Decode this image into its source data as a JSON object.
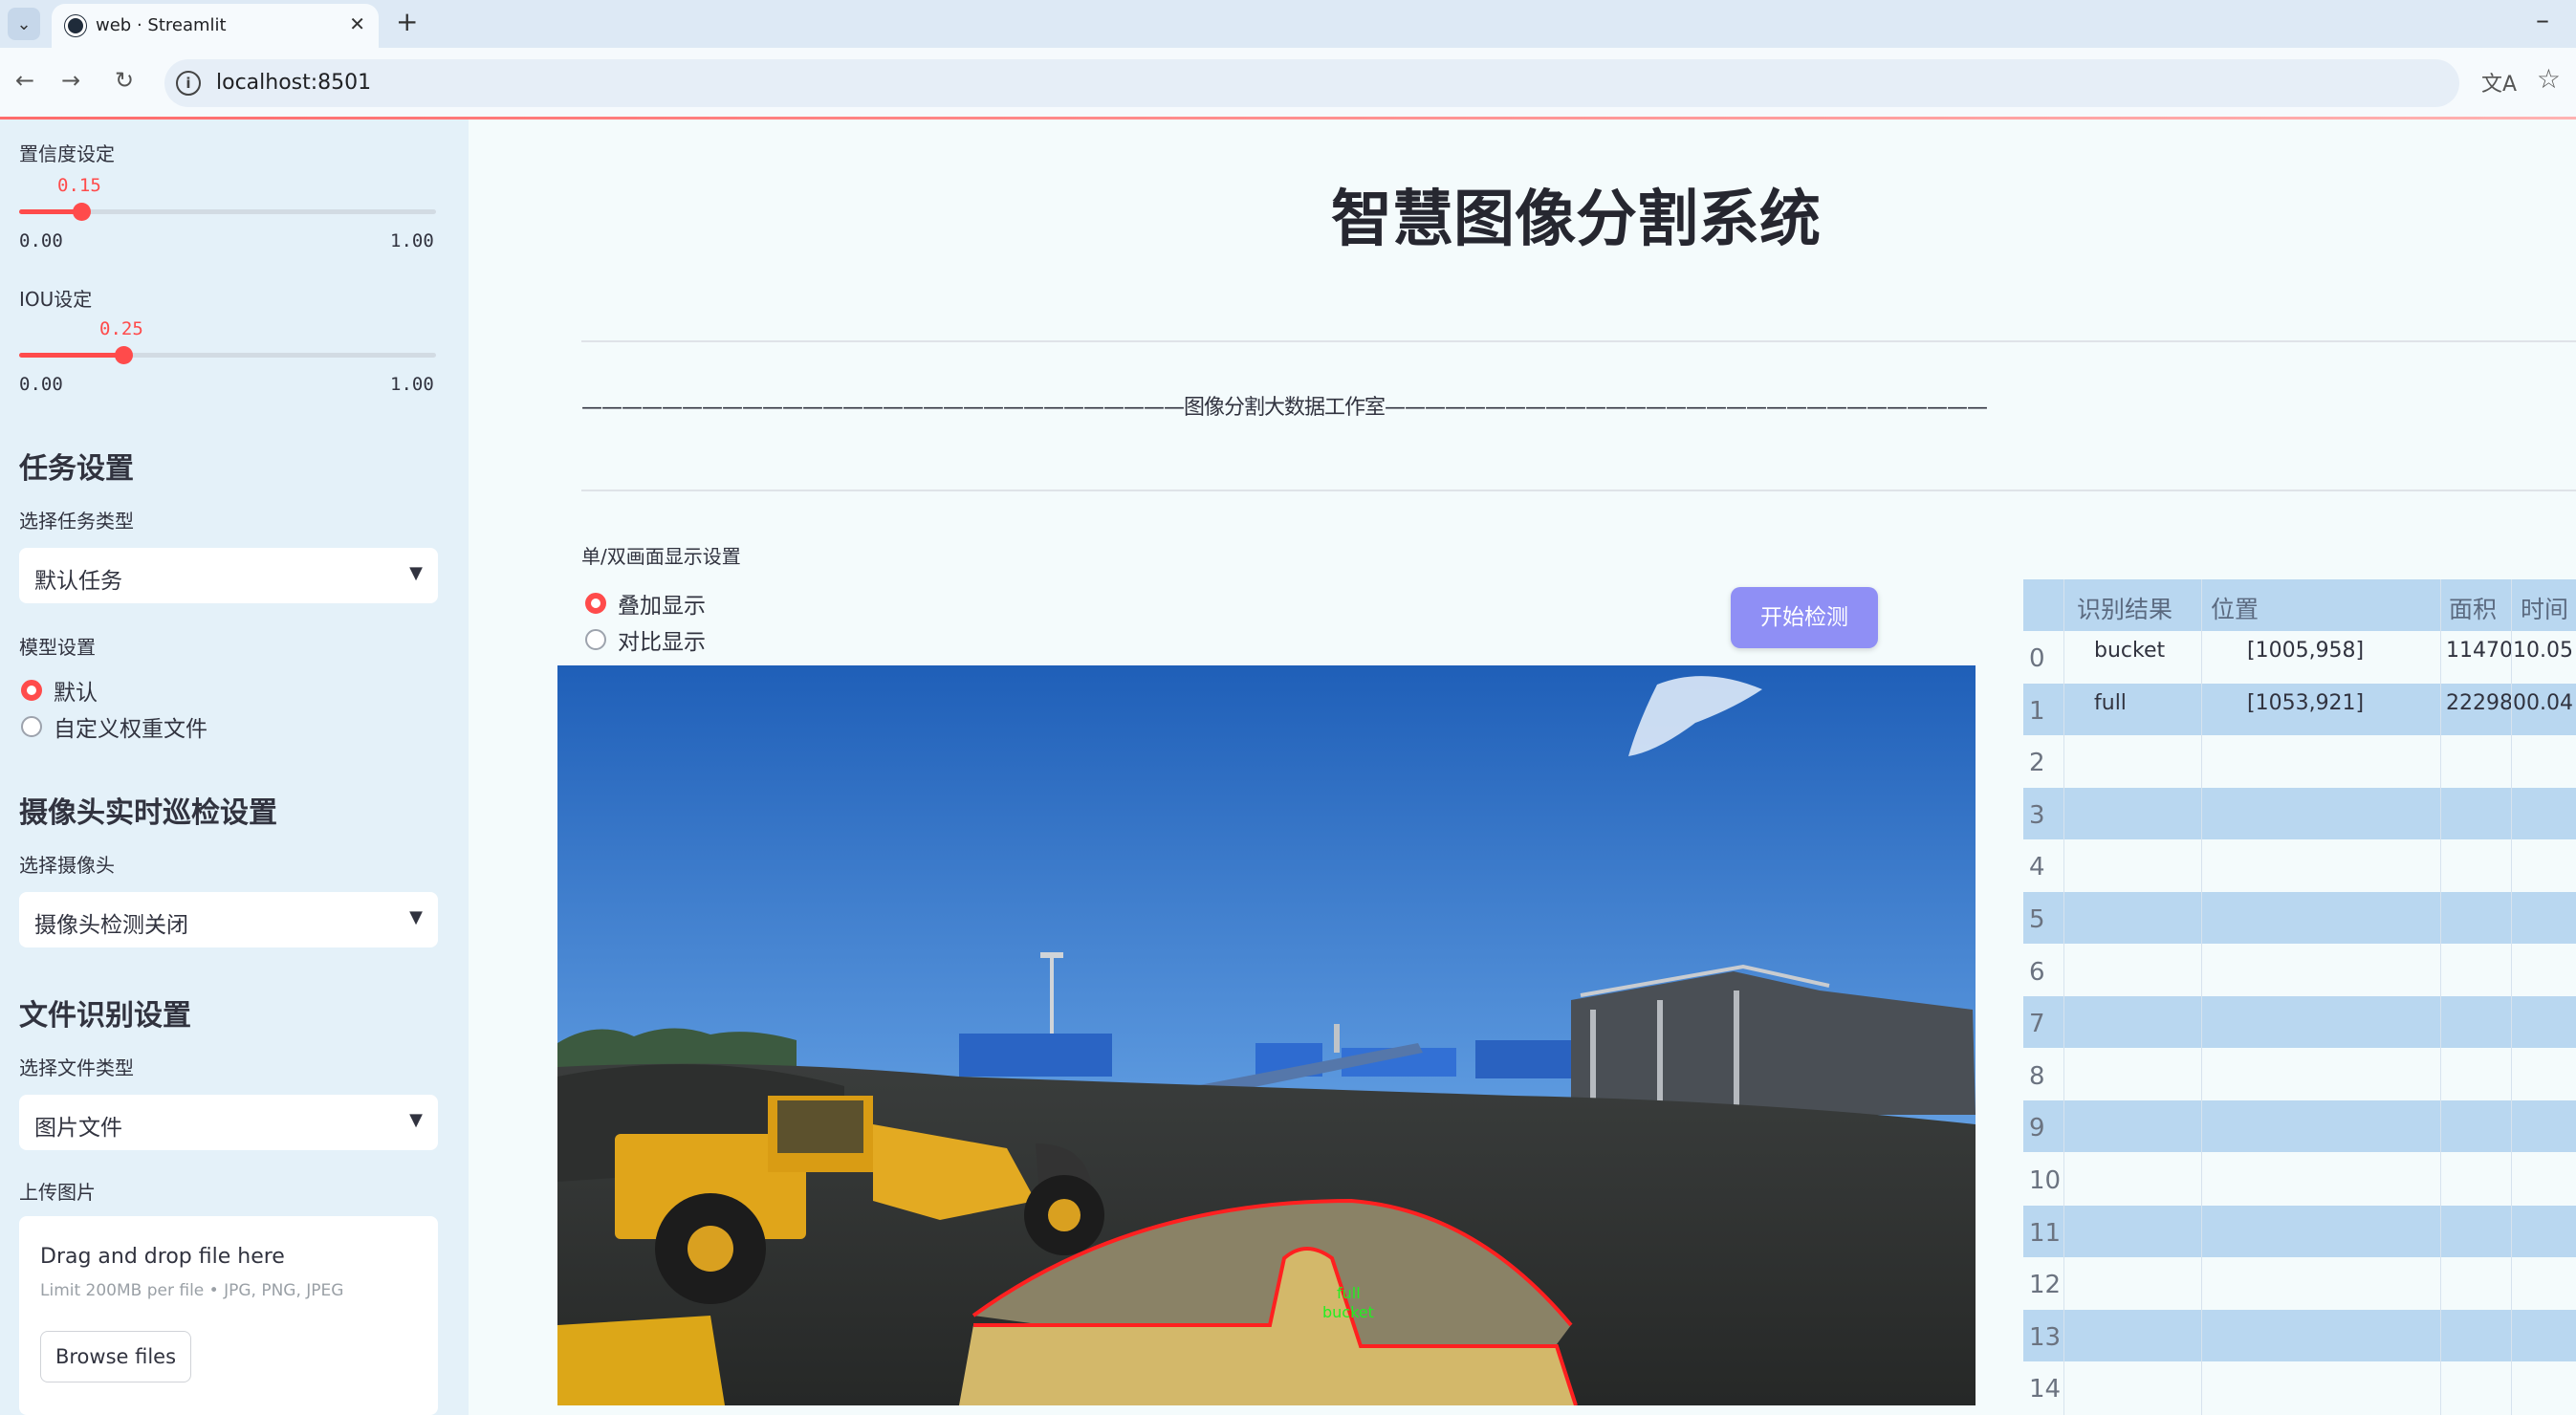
{
  "browser": {
    "tab_title": "web · Streamlit",
    "tab_close": "✕",
    "new_tab": "+",
    "url": "localhost:8501"
  },
  "sidebar": {
    "confidence": {
      "label": "置信度设定",
      "value": "0.15",
      "value_fraction": 0.15,
      "min": "0.00",
      "max": "1.00"
    },
    "iou": {
      "label": "IOU设定",
      "value": "0.25",
      "value_fraction": 0.25,
      "min": "0.00",
      "max": "1.00"
    },
    "task": {
      "heading": "任务设置",
      "label": "选择任务类型",
      "selected": "默认任务"
    },
    "model": {
      "label": "模型设置",
      "options": [
        "默认",
        "自定义权重文件"
      ],
      "selected_index": 0
    },
    "camera": {
      "heading": "摄像头实时巡检设置",
      "label": "选择摄像头",
      "selected": "摄像头检测关闭"
    },
    "file": {
      "heading": "文件识别设置",
      "label": "选择文件类型",
      "selected": "图片文件",
      "upload_label": "上传图片"
    },
    "uploader": {
      "title": "Drag and drop file here",
      "limit": "Limit 200MB per file • JPG, PNG, JPEG",
      "button": "Browse files"
    }
  },
  "main": {
    "title": "智慧图像分割系统",
    "divider_text": "——————————————————————————————图像分割大数据工作室——————————————————————————————",
    "display_label": "单/双画面显示设置",
    "display_options": [
      "叠加显示",
      "对比显示"
    ],
    "display_selected_index": 0,
    "start_button": "开始检测",
    "detections": [
      {
        "label": "full"
      },
      {
        "label": "bucket"
      }
    ]
  },
  "table": {
    "columns": [
      "识别结果",
      "位置",
      "面积",
      "时间"
    ],
    "rows": [
      {
        "index": "0",
        "result": "bucket",
        "position": "[1005,958]",
        "area": "1147010.05"
      },
      {
        "index": "1",
        "result": "full",
        "position": "[1053,921]",
        "area": "2229800.04"
      },
      {
        "index": "2",
        "result": "",
        "position": "",
        "area": ""
      },
      {
        "index": "3",
        "result": "",
        "position": "",
        "area": ""
      },
      {
        "index": "4",
        "result": "",
        "position": "",
        "area": ""
      },
      {
        "index": "5",
        "result": "",
        "position": "",
        "area": ""
      },
      {
        "index": "6",
        "result": "",
        "position": "",
        "area": ""
      },
      {
        "index": "7",
        "result": "",
        "position": "",
        "area": ""
      },
      {
        "index": "8",
        "result": "",
        "position": "",
        "area": ""
      },
      {
        "index": "9",
        "result": "",
        "position": "",
        "area": ""
      },
      {
        "index": "10",
        "result": "",
        "position": "",
        "area": ""
      },
      {
        "index": "11",
        "result": "",
        "position": "",
        "area": ""
      },
      {
        "index": "12",
        "result": "",
        "position": "",
        "area": ""
      },
      {
        "index": "13",
        "result": "",
        "position": "",
        "area": ""
      },
      {
        "index": "14",
        "result": "",
        "position": "",
        "area": ""
      }
    ]
  },
  "colors": {
    "accent": "#ff4b4b",
    "button": "#8f8ff5",
    "table_stripe": "#b9d7f0",
    "sidebar_bg": "#e4f1f9"
  }
}
